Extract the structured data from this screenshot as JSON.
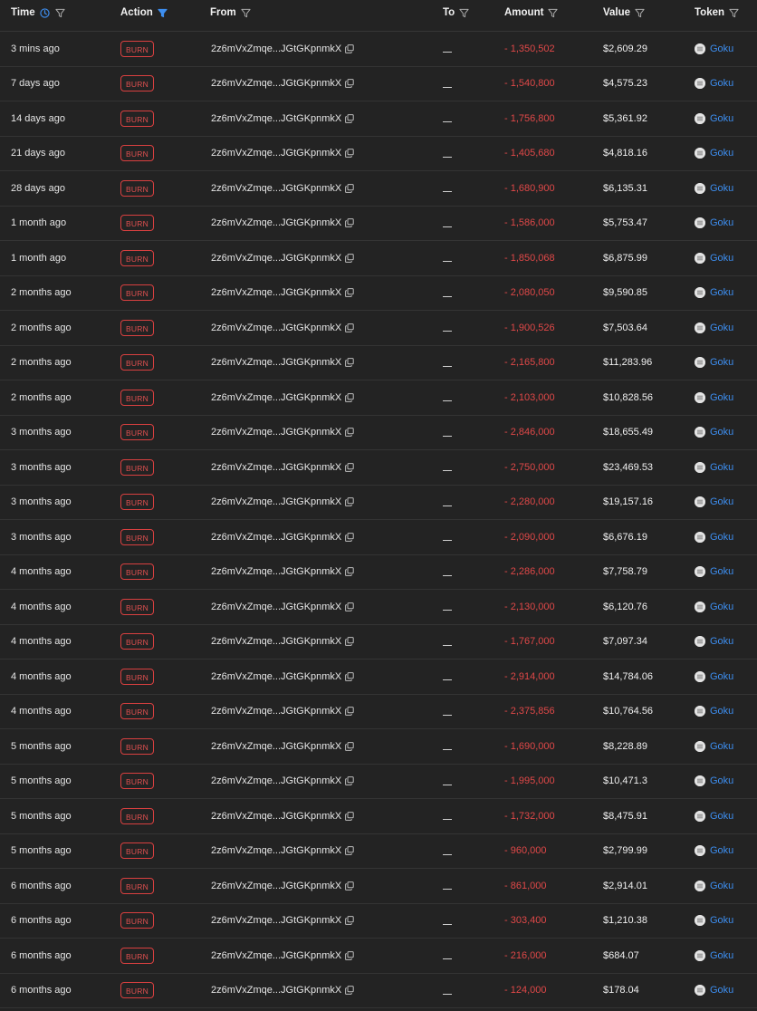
{
  "header": {
    "time": "Time",
    "action": "Action",
    "from": "From",
    "to": "To",
    "amount": "Amount",
    "value": "Value",
    "token": "Token"
  },
  "rows": [
    {
      "time": "3 mins ago",
      "action": "BURN",
      "from": "2z6mVxZmqe...JGtGKpnmkX",
      "to": "",
      "amount": "- 1,350,502",
      "value": "$2,609.29",
      "token": "Goku"
    },
    {
      "time": "7 days ago",
      "action": "BURN",
      "from": "2z6mVxZmqe...JGtGKpnmkX",
      "to": "",
      "amount": "- 1,540,800",
      "value": "$4,575.23",
      "token": "Goku"
    },
    {
      "time": "14 days ago",
      "action": "BURN",
      "from": "2z6mVxZmqe...JGtGKpnmkX",
      "to": "",
      "amount": "- 1,756,800",
      "value": "$5,361.92",
      "token": "Goku"
    },
    {
      "time": "21 days ago",
      "action": "BURN",
      "from": "2z6mVxZmqe...JGtGKpnmkX",
      "to": "",
      "amount": "- 1,405,680",
      "value": "$4,818.16",
      "token": "Goku"
    },
    {
      "time": "28 days ago",
      "action": "BURN",
      "from": "2z6mVxZmqe...JGtGKpnmkX",
      "to": "",
      "amount": "- 1,680,900",
      "value": "$6,135.31",
      "token": "Goku"
    },
    {
      "time": "1 month ago",
      "action": "BURN",
      "from": "2z6mVxZmqe...JGtGKpnmkX",
      "to": "",
      "amount": "- 1,586,000",
      "value": "$5,753.47",
      "token": "Goku"
    },
    {
      "time": "1 month ago",
      "action": "BURN",
      "from": "2z6mVxZmqe...JGtGKpnmkX",
      "to": "",
      "amount": "- 1,850,068",
      "value": "$6,875.99",
      "token": "Goku"
    },
    {
      "time": "2 months ago",
      "action": "BURN",
      "from": "2z6mVxZmqe...JGtGKpnmkX",
      "to": "",
      "amount": "- 2,080,050",
      "value": "$9,590.85",
      "token": "Goku"
    },
    {
      "time": "2 months ago",
      "action": "BURN",
      "from": "2z6mVxZmqe...JGtGKpnmkX",
      "to": "",
      "amount": "- 1,900,526",
      "value": "$7,503.64",
      "token": "Goku"
    },
    {
      "time": "2 months ago",
      "action": "BURN",
      "from": "2z6mVxZmqe...JGtGKpnmkX",
      "to": "",
      "amount": "- 2,165,800",
      "value": "$11,283.96",
      "token": "Goku"
    },
    {
      "time": "2 months ago",
      "action": "BURN",
      "from": "2z6mVxZmqe...JGtGKpnmkX",
      "to": "",
      "amount": "- 2,103,000",
      "value": "$10,828.56",
      "token": "Goku"
    },
    {
      "time": "3 months ago",
      "action": "BURN",
      "from": "2z6mVxZmqe...JGtGKpnmkX",
      "to": "",
      "amount": "- 2,846,000",
      "value": "$18,655.49",
      "token": "Goku"
    },
    {
      "time": "3 months ago",
      "action": "BURN",
      "from": "2z6mVxZmqe...JGtGKpnmkX",
      "to": "",
      "amount": "- 2,750,000",
      "value": "$23,469.53",
      "token": "Goku"
    },
    {
      "time": "3 months ago",
      "action": "BURN",
      "from": "2z6mVxZmqe...JGtGKpnmkX",
      "to": "",
      "amount": "- 2,280,000",
      "value": "$19,157.16",
      "token": "Goku"
    },
    {
      "time": "3 months ago",
      "action": "BURN",
      "from": "2z6mVxZmqe...JGtGKpnmkX",
      "to": "",
      "amount": "- 2,090,000",
      "value": "$6,676.19",
      "token": "Goku"
    },
    {
      "time": "4 months ago",
      "action": "BURN",
      "from": "2z6mVxZmqe...JGtGKpnmkX",
      "to": "",
      "amount": "- 2,286,000",
      "value": "$7,758.79",
      "token": "Goku"
    },
    {
      "time": "4 months ago",
      "action": "BURN",
      "from": "2z6mVxZmqe...JGtGKpnmkX",
      "to": "",
      "amount": "- 2,130,000",
      "value": "$6,120.76",
      "token": "Goku"
    },
    {
      "time": "4 months ago",
      "action": "BURN",
      "from": "2z6mVxZmqe...JGtGKpnmkX",
      "to": "",
      "amount": "- 1,767,000",
      "value": "$7,097.34",
      "token": "Goku"
    },
    {
      "time": "4 months ago",
      "action": "BURN",
      "from": "2z6mVxZmqe...JGtGKpnmkX",
      "to": "",
      "amount": "- 2,914,000",
      "value": "$14,784.06",
      "token": "Goku"
    },
    {
      "time": "4 months ago",
      "action": "BURN",
      "from": "2z6mVxZmqe...JGtGKpnmkX",
      "to": "",
      "amount": "- 2,375,856",
      "value": "$10,764.56",
      "token": "Goku"
    },
    {
      "time": "5 months ago",
      "action": "BURN",
      "from": "2z6mVxZmqe...JGtGKpnmkX",
      "to": "",
      "amount": "- 1,690,000",
      "value": "$8,228.89",
      "token": "Goku"
    },
    {
      "time": "5 months ago",
      "action": "BURN",
      "from": "2z6mVxZmqe...JGtGKpnmkX",
      "to": "",
      "amount": "- 1,995,000",
      "value": "$10,471.3",
      "token": "Goku"
    },
    {
      "time": "5 months ago",
      "action": "BURN",
      "from": "2z6mVxZmqe...JGtGKpnmkX",
      "to": "",
      "amount": "- 1,732,000",
      "value": "$8,475.91",
      "token": "Goku"
    },
    {
      "time": "5 months ago",
      "action": "BURN",
      "from": "2z6mVxZmqe...JGtGKpnmkX",
      "to": "",
      "amount": "- 960,000",
      "value": "$2,799.99",
      "token": "Goku"
    },
    {
      "time": "6 months ago",
      "action": "BURN",
      "from": "2z6mVxZmqe...JGtGKpnmkX",
      "to": "",
      "amount": "- 861,000",
      "value": "$2,914.01",
      "token": "Goku"
    },
    {
      "time": "6 months ago",
      "action": "BURN",
      "from": "2z6mVxZmqe...JGtGKpnmkX",
      "to": "",
      "amount": "- 303,400",
      "value": "$1,210.38",
      "token": "Goku"
    },
    {
      "time": "6 months ago",
      "action": "BURN",
      "from": "2z6mVxZmqe...JGtGKpnmkX",
      "to": "",
      "amount": "- 216,000",
      "value": "$684.07",
      "token": "Goku"
    },
    {
      "time": "6 months ago",
      "action": "BURN",
      "from": "2z6mVxZmqe...JGtGKpnmkX",
      "to": "",
      "amount": "- 124,000",
      "value": "$178.04",
      "token": "Goku"
    }
  ],
  "icons": {
    "filter": "filter-icon",
    "filter_active": "filter-active-icon",
    "clock": "clock-icon",
    "copy": "copy-icon",
    "token_logo": "goku-token-icon"
  },
  "colors": {
    "background": "#232323",
    "burn": "#e04848",
    "link": "#3d8ef0",
    "active_filter": "#3d8ef0"
  }
}
